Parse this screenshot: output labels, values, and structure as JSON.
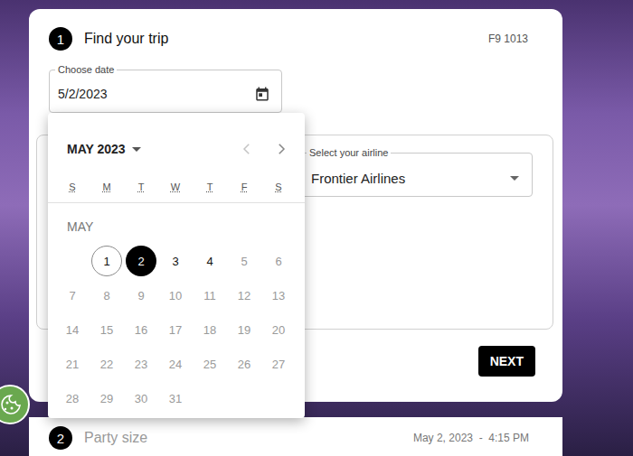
{
  "step1": {
    "number": "1",
    "title": "Find your trip",
    "flight": "F9 1013"
  },
  "date_field": {
    "label": "Choose date",
    "value": "5/2/2023"
  },
  "airline_field": {
    "label": "Select your airline",
    "value": "Frontier Airlines"
  },
  "calendar": {
    "month_label": "MAY 2023",
    "prev_disabled": true,
    "next_disabled": false,
    "weekdays": [
      "S",
      "M",
      "T",
      "W",
      "T",
      "F",
      "S"
    ],
    "section": "MAY",
    "start_weekday": 1,
    "days": [
      {
        "day": "1",
        "today": true,
        "selected": false,
        "disabled": false
      },
      {
        "day": "2",
        "today": false,
        "selected": true,
        "disabled": false
      },
      {
        "day": "3",
        "today": false,
        "selected": false,
        "disabled": false
      },
      {
        "day": "4",
        "today": false,
        "selected": false,
        "disabled": false
      },
      {
        "day": "5",
        "today": false,
        "selected": false,
        "disabled": true
      },
      {
        "day": "6",
        "today": false,
        "selected": false,
        "disabled": true
      },
      {
        "day": "7",
        "today": false,
        "selected": false,
        "disabled": true
      },
      {
        "day": "8",
        "today": false,
        "selected": false,
        "disabled": true
      },
      {
        "day": "9",
        "today": false,
        "selected": false,
        "disabled": true
      },
      {
        "day": "10",
        "today": false,
        "selected": false,
        "disabled": true
      },
      {
        "day": "11",
        "today": false,
        "selected": false,
        "disabled": true
      },
      {
        "day": "12",
        "today": false,
        "selected": false,
        "disabled": true
      },
      {
        "day": "13",
        "today": false,
        "selected": false,
        "disabled": true
      },
      {
        "day": "14",
        "today": false,
        "selected": false,
        "disabled": true
      },
      {
        "day": "15",
        "today": false,
        "selected": false,
        "disabled": true
      },
      {
        "day": "16",
        "today": false,
        "selected": false,
        "disabled": true
      },
      {
        "day": "17",
        "today": false,
        "selected": false,
        "disabled": true
      },
      {
        "day": "18",
        "today": false,
        "selected": false,
        "disabled": true
      },
      {
        "day": "19",
        "today": false,
        "selected": false,
        "disabled": true
      },
      {
        "day": "20",
        "today": false,
        "selected": false,
        "disabled": true
      },
      {
        "day": "21",
        "today": false,
        "selected": false,
        "disabled": true
      },
      {
        "day": "22",
        "today": false,
        "selected": false,
        "disabled": true
      },
      {
        "day": "23",
        "today": false,
        "selected": false,
        "disabled": true
      },
      {
        "day": "24",
        "today": false,
        "selected": false,
        "disabled": true
      },
      {
        "day": "25",
        "today": false,
        "selected": false,
        "disabled": true
      },
      {
        "day": "26",
        "today": false,
        "selected": false,
        "disabled": true
      },
      {
        "day": "27",
        "today": false,
        "selected": false,
        "disabled": true
      },
      {
        "day": "28",
        "today": false,
        "selected": false,
        "disabled": true
      },
      {
        "day": "29",
        "today": false,
        "selected": false,
        "disabled": true
      },
      {
        "day": "30",
        "today": false,
        "selected": false,
        "disabled": true
      },
      {
        "day": "31",
        "today": false,
        "selected": false,
        "disabled": true
      }
    ]
  },
  "next_button": "NEXT",
  "step2": {
    "number": "2",
    "title": "Party size",
    "summary": "May 2, 2023  -  4:15 PM",
    "active": false
  }
}
